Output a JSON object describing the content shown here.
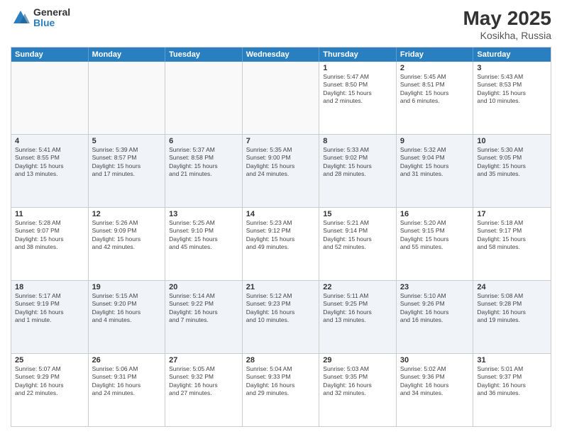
{
  "logo": {
    "general": "General",
    "blue": "Blue"
  },
  "title": {
    "month": "May 2025",
    "location": "Kosikha, Russia"
  },
  "header_days": [
    "Sunday",
    "Monday",
    "Tuesday",
    "Wednesday",
    "Thursday",
    "Friday",
    "Saturday"
  ],
  "rows": [
    {
      "alt": false,
      "cells": [
        {
          "empty": true,
          "day": "",
          "info": ""
        },
        {
          "empty": true,
          "day": "",
          "info": ""
        },
        {
          "empty": true,
          "day": "",
          "info": ""
        },
        {
          "empty": true,
          "day": "",
          "info": ""
        },
        {
          "empty": false,
          "day": "1",
          "info": "Sunrise: 5:47 AM\nSunset: 8:50 PM\nDaylight: 15 hours\nand 2 minutes."
        },
        {
          "empty": false,
          "day": "2",
          "info": "Sunrise: 5:45 AM\nSunset: 8:51 PM\nDaylight: 15 hours\nand 6 minutes."
        },
        {
          "empty": false,
          "day": "3",
          "info": "Sunrise: 5:43 AM\nSunset: 8:53 PM\nDaylight: 15 hours\nand 10 minutes."
        }
      ]
    },
    {
      "alt": true,
      "cells": [
        {
          "empty": false,
          "day": "4",
          "info": "Sunrise: 5:41 AM\nSunset: 8:55 PM\nDaylight: 15 hours\nand 13 minutes."
        },
        {
          "empty": false,
          "day": "5",
          "info": "Sunrise: 5:39 AM\nSunset: 8:57 PM\nDaylight: 15 hours\nand 17 minutes."
        },
        {
          "empty": false,
          "day": "6",
          "info": "Sunrise: 5:37 AM\nSunset: 8:58 PM\nDaylight: 15 hours\nand 21 minutes."
        },
        {
          "empty": false,
          "day": "7",
          "info": "Sunrise: 5:35 AM\nSunset: 9:00 PM\nDaylight: 15 hours\nand 24 minutes."
        },
        {
          "empty": false,
          "day": "8",
          "info": "Sunrise: 5:33 AM\nSunset: 9:02 PM\nDaylight: 15 hours\nand 28 minutes."
        },
        {
          "empty": false,
          "day": "9",
          "info": "Sunrise: 5:32 AM\nSunset: 9:04 PM\nDaylight: 15 hours\nand 31 minutes."
        },
        {
          "empty": false,
          "day": "10",
          "info": "Sunrise: 5:30 AM\nSunset: 9:05 PM\nDaylight: 15 hours\nand 35 minutes."
        }
      ]
    },
    {
      "alt": false,
      "cells": [
        {
          "empty": false,
          "day": "11",
          "info": "Sunrise: 5:28 AM\nSunset: 9:07 PM\nDaylight: 15 hours\nand 38 minutes."
        },
        {
          "empty": false,
          "day": "12",
          "info": "Sunrise: 5:26 AM\nSunset: 9:09 PM\nDaylight: 15 hours\nand 42 minutes."
        },
        {
          "empty": false,
          "day": "13",
          "info": "Sunrise: 5:25 AM\nSunset: 9:10 PM\nDaylight: 15 hours\nand 45 minutes."
        },
        {
          "empty": false,
          "day": "14",
          "info": "Sunrise: 5:23 AM\nSunset: 9:12 PM\nDaylight: 15 hours\nand 49 minutes."
        },
        {
          "empty": false,
          "day": "15",
          "info": "Sunrise: 5:21 AM\nSunset: 9:14 PM\nDaylight: 15 hours\nand 52 minutes."
        },
        {
          "empty": false,
          "day": "16",
          "info": "Sunrise: 5:20 AM\nSunset: 9:15 PM\nDaylight: 15 hours\nand 55 minutes."
        },
        {
          "empty": false,
          "day": "17",
          "info": "Sunrise: 5:18 AM\nSunset: 9:17 PM\nDaylight: 15 hours\nand 58 minutes."
        }
      ]
    },
    {
      "alt": true,
      "cells": [
        {
          "empty": false,
          "day": "18",
          "info": "Sunrise: 5:17 AM\nSunset: 9:19 PM\nDaylight: 16 hours\nand 1 minute."
        },
        {
          "empty": false,
          "day": "19",
          "info": "Sunrise: 5:15 AM\nSunset: 9:20 PM\nDaylight: 16 hours\nand 4 minutes."
        },
        {
          "empty": false,
          "day": "20",
          "info": "Sunrise: 5:14 AM\nSunset: 9:22 PM\nDaylight: 16 hours\nand 7 minutes."
        },
        {
          "empty": false,
          "day": "21",
          "info": "Sunrise: 5:12 AM\nSunset: 9:23 PM\nDaylight: 16 hours\nand 10 minutes."
        },
        {
          "empty": false,
          "day": "22",
          "info": "Sunrise: 5:11 AM\nSunset: 9:25 PM\nDaylight: 16 hours\nand 13 minutes."
        },
        {
          "empty": false,
          "day": "23",
          "info": "Sunrise: 5:10 AM\nSunset: 9:26 PM\nDaylight: 16 hours\nand 16 minutes."
        },
        {
          "empty": false,
          "day": "24",
          "info": "Sunrise: 5:08 AM\nSunset: 9:28 PM\nDaylight: 16 hours\nand 19 minutes."
        }
      ]
    },
    {
      "alt": false,
      "cells": [
        {
          "empty": false,
          "day": "25",
          "info": "Sunrise: 5:07 AM\nSunset: 9:29 PM\nDaylight: 16 hours\nand 22 minutes."
        },
        {
          "empty": false,
          "day": "26",
          "info": "Sunrise: 5:06 AM\nSunset: 9:31 PM\nDaylight: 16 hours\nand 24 minutes."
        },
        {
          "empty": false,
          "day": "27",
          "info": "Sunrise: 5:05 AM\nSunset: 9:32 PM\nDaylight: 16 hours\nand 27 minutes."
        },
        {
          "empty": false,
          "day": "28",
          "info": "Sunrise: 5:04 AM\nSunset: 9:33 PM\nDaylight: 16 hours\nand 29 minutes."
        },
        {
          "empty": false,
          "day": "29",
          "info": "Sunrise: 5:03 AM\nSunset: 9:35 PM\nDaylight: 16 hours\nand 32 minutes."
        },
        {
          "empty": false,
          "day": "30",
          "info": "Sunrise: 5:02 AM\nSunset: 9:36 PM\nDaylight: 16 hours\nand 34 minutes."
        },
        {
          "empty": false,
          "day": "31",
          "info": "Sunrise: 5:01 AM\nSunset: 9:37 PM\nDaylight: 16 hours\nand 36 minutes."
        }
      ]
    }
  ]
}
